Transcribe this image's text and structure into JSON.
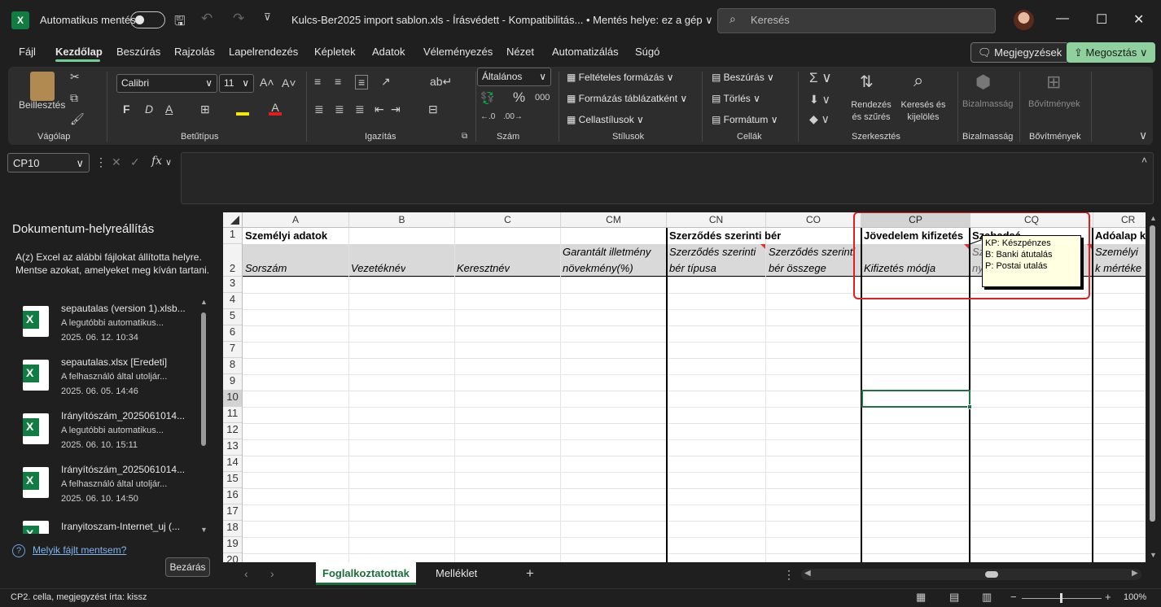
{
  "titlebar": {
    "autosave_label": "Automatikus mentés",
    "title": "Kulcs-Ber2025 import sablon.xls  -  Írásvédett  -  Kompatibilitás...  •  Mentés helye: ez a gép ∨",
    "search_placeholder": "Keresés",
    "minimize": "—",
    "maximize": "☐",
    "close": "✕"
  },
  "menu": {
    "items": [
      "Fájl",
      "Kezdőlap",
      "Beszúrás",
      "Rajzolás",
      "Lapelrendezés",
      "Képletek",
      "Adatok",
      "Véleményezés",
      "Nézet",
      "Automatizálás",
      "Súgó"
    ],
    "comments": "Megjegyzések",
    "share": "Megosztás"
  },
  "ribbon": {
    "clipboard": {
      "paste": "Beillesztés",
      "group": "Vágólap"
    },
    "font": {
      "name": "Calibri",
      "size": "11",
      "bold": "F",
      "italic": "D",
      "underline": "A",
      "group": "Betűtípus"
    },
    "align": {
      "group": "Igazítás"
    },
    "number": {
      "format": "Általános",
      "percent": "%",
      "thousands": "000",
      "group": "Szám"
    },
    "styles": {
      "cond": "Feltételes formázás",
      "table": "Formázás táblázatként",
      "cell": "Cellastílusok",
      "group": "Stílusok"
    },
    "cells": {
      "insert": "Beszúrás",
      "delete": "Törlés",
      "format": "Formátum",
      "group": "Cellák"
    },
    "editing": {
      "sort": "Rendezés és szűrés",
      "find": "Keresés és kijelölés",
      "group": "Szerkesztés"
    },
    "sensitivity": {
      "label": "Bizalmasság",
      "group": "Bizalmasság"
    },
    "addins": {
      "label": "Bővítmények",
      "group": "Bővítmények"
    }
  },
  "formula_bar": {
    "name_box": "CP10",
    "fx": "fx",
    "value": ""
  },
  "recovery": {
    "title": "Dokumentum-helyreállítás",
    "intro": "A(z) Excel az alábbi fájlokat állította helyre. Mentse azokat, amelyeket meg kíván tartani.",
    "files": [
      {
        "name": "sepautalas (version 1).xlsb...",
        "desc": "A legutóbbi automatikus...",
        "date": "2025. 06. 12. 10:34"
      },
      {
        "name": "sepautalas.xlsx  [Eredeti]",
        "desc": "A felhasználó által utoljár...",
        "date": "2025. 06. 05. 14:46"
      },
      {
        "name": "Irányítószám_2025061014...",
        "desc": "A legutóbbi automatikus...",
        "date": "2025. 06. 10. 15:11"
      },
      {
        "name": "Irányítószám_2025061014...",
        "desc": "A felhasználó által utoljár...",
        "date": "2025. 06. 10. 14:50"
      },
      {
        "name": "Iranyitoszam-Internet_uj (...",
        "desc": "A felhasználó által utoljár...",
        "date": ""
      }
    ],
    "which_link": "Melyik fájlt mentsem?",
    "close": "Bezárás"
  },
  "sheet": {
    "columns": [
      "A",
      "B",
      "C",
      "CM",
      "CN",
      "CO",
      "CP",
      "CQ",
      "CR"
    ],
    "rows": [
      "1",
      "2",
      "3",
      "4",
      "5",
      "6",
      "7",
      "8",
      "9",
      "10",
      "11",
      "12",
      "13",
      "14",
      "15",
      "16",
      "17",
      "18",
      "19",
      "20"
    ],
    "r1": {
      "A": "Személyi adatok",
      "CN": "Szerződés szerinti bér",
      "CP": "Jövedelem kifizetés",
      "CQ": "Szabadság adatok",
      "CR": "Adóalap k"
    },
    "r2": {
      "A": "Sorszám",
      "B": "Vezetéknév",
      "C": "Keresztnév",
      "CM": "Garantált illetmény növekmény(%)",
      "CN": "Szerződés szerinti bér típusa",
      "CO": "Szerződés szerinti bér összege",
      "CP": "Kifizetés módja",
      "CQ": "Sza ny",
      "CR": "Személyi k mértéke"
    },
    "comment": [
      "KP:  Készpénzes",
      "B:    Banki átutalás",
      "P:    Postai utalás"
    ]
  },
  "tabs": {
    "active": "Foglalkoztatottak",
    "other": "Melléklet",
    "add": "+"
  },
  "status": {
    "text": "CP2. cella, megjegyzést írta: kissz",
    "zoom": "100%"
  }
}
